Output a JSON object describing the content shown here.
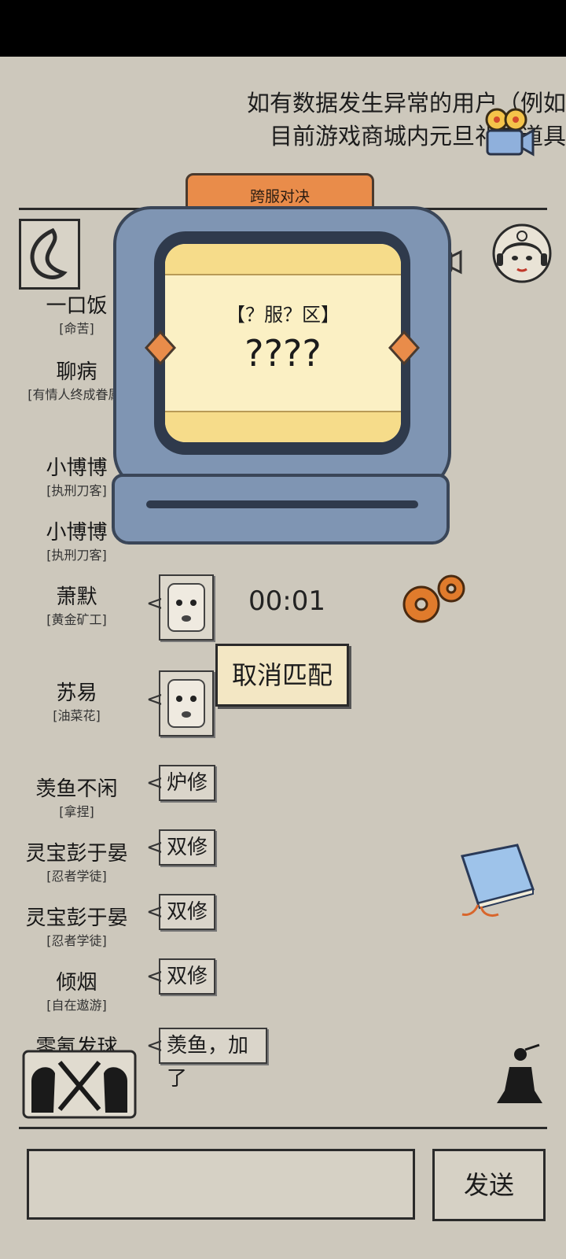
{
  "notice": {
    "line1": "如有数据发生异常的用户（例如",
    "line2": "目前游戏商城内元旦礼包道具"
  },
  "messages": [
    {
      "name": "一口饭",
      "title": "[命苦]"
    },
    {
      "name": "聊病",
      "title": "[有情人终成眷属]"
    },
    {
      "name": "小博博",
      "title": "[执刑刀客]"
    },
    {
      "name": "小博博",
      "title": "[执刑刀客]"
    },
    {
      "name": "萧默",
      "title": "[黄金矿工]"
    },
    {
      "name": "苏易",
      "title": "[油菜花]"
    },
    {
      "name": "羡鱼不闲",
      "title": "[拿捏]",
      "text": "炉修"
    },
    {
      "name": "灵宝彭于晏",
      "title": "[忍者学徒]",
      "text": "双修"
    },
    {
      "name": "灵宝彭于晏",
      "title": "[忍者学徒]",
      "text": "双修"
    },
    {
      "name": "倾烟",
      "title": "[自在遨游]",
      "text": "双修"
    },
    {
      "name": "零氪发球",
      "title": "",
      "text": "羡鱼，加了"
    }
  ],
  "match": {
    "tab_label": "跨服对决",
    "server": "【？服？区】",
    "player": "????",
    "timer": "00:01",
    "cancel_label": "取消匹配"
  },
  "input": {
    "value": "",
    "send_label": "发送"
  },
  "icons": {
    "camera": "film-camera-icon",
    "back": "back-arrow-icon",
    "avatar": "character-avatar-icon",
    "gear": "gear-icon",
    "book": "book-icon",
    "battle": "crossed-swords-icon",
    "monk": "meditating-figure-icon"
  },
  "colors": {
    "background": "#cdc8bc",
    "tv_blue": "#7f95b3",
    "tab_orange": "#e98c4a",
    "screen_cream": "#fbf0c4"
  }
}
